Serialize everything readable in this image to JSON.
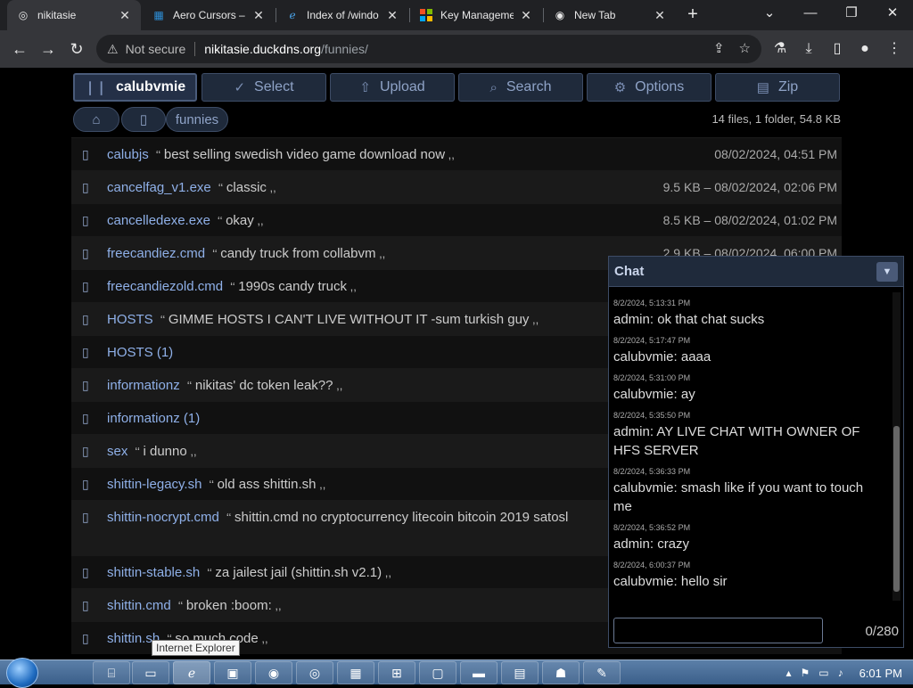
{
  "browser": {
    "tabs": [
      {
        "title": "nikitasie",
        "icon": "globe-icon",
        "active": true
      },
      {
        "title": "Aero Cursors – W",
        "icon": "windows-icon",
        "active": false
      },
      {
        "title": "Index of /windo",
        "icon": "ie-icon",
        "active": false
      },
      {
        "title": "Key Managemen",
        "icon": "microsoft-icon",
        "active": false
      },
      {
        "title": "New Tab",
        "icon": "chrome-icon",
        "active": false
      }
    ],
    "new_tab": "+",
    "address": {
      "security": "Not secure",
      "host": "nikitasie.duckdns.org",
      "path": "/funnies/"
    }
  },
  "hfs": {
    "buttons": [
      {
        "label": "calubvmie",
        "icon": "user-icon"
      },
      {
        "label": "Select",
        "icon": "check-icon"
      },
      {
        "label": "Upload",
        "icon": "upload-icon"
      },
      {
        "label": "Search",
        "icon": "search-icon"
      },
      {
        "label": "Options",
        "icon": "gear-icon"
      },
      {
        "label": "Zip",
        "icon": "zip-icon"
      }
    ],
    "breadcrumb": [
      {
        "label": "",
        "icon": "home-icon"
      },
      {
        "label": "",
        "icon": "folder-up-icon"
      },
      {
        "label": "funnies",
        "icon": ""
      }
    ],
    "summary": "14 files, 1 folder, 54.8 KB",
    "files": [
      {
        "name": "calubjs",
        "comment": "best selling swedish video game download now",
        "meta": "08/02/2024, 04:51 PM"
      },
      {
        "name": "cancelfag_v1.exe",
        "comment": "classic",
        "meta": "9.5 KB – 08/02/2024, 02:06 PM"
      },
      {
        "name": "cancelledexe.exe",
        "comment": "okay",
        "meta": "8.5 KB – 08/02/2024, 01:02 PM"
      },
      {
        "name": "freecandiez.cmd",
        "comment": "candy truck from collabvm",
        "meta": "2.9 KB – 08/02/2024, 06:00 PM"
      },
      {
        "name": "freecandiezold.cmd",
        "comment": "1990s candy truck",
        "meta": ""
      },
      {
        "name": "HOSTS",
        "comment": "GIMME HOSTS I CAN'T LIVE WITHOUT IT -sum turkish guy",
        "meta": ""
      },
      {
        "name": "HOSTS (1)",
        "comment": "",
        "meta": ""
      },
      {
        "name": "informationz",
        "comment": "nikitas' dc token leak??",
        "meta": ""
      },
      {
        "name": "informationz (1)",
        "comment": "",
        "meta": ""
      },
      {
        "name": "sex",
        "comment": "i dunno",
        "meta": ""
      },
      {
        "name": "shittin-legacy.sh",
        "comment": "old ass shittin.sh",
        "meta": ""
      },
      {
        "name": "shittin-nocrypt.cmd",
        "comment": "shittin.cmd no cryptocurrency litecoin bitcoin 2019 satosl",
        "meta": ""
      },
      {
        "name": "shittin-stable.sh",
        "comment": "za jailest jail (shittin.sh v2.1)",
        "meta": ""
      },
      {
        "name": "shittin.cmd",
        "comment": "broken :boom:",
        "meta": ""
      },
      {
        "name": "shittin.sh",
        "comment": "so much code",
        "meta": ""
      }
    ]
  },
  "chat": {
    "title": "Chat",
    "messages": [
      {
        "ts": "8/2/2024, 5:13:31 PM",
        "text": "admin: ok that chat sucks"
      },
      {
        "ts": "8/2/2024, 5:17:47 PM",
        "text": "calubvmie: aaaa"
      },
      {
        "ts": "8/2/2024, 5:31:00 PM",
        "text": "calubvmie: ay"
      },
      {
        "ts": "8/2/2024, 5:35:50 PM",
        "text": "admin: AY LIVE CHAT WITH OWNER OF HFS SERVER"
      },
      {
        "ts": "8/2/2024, 5:36:33 PM",
        "text": "calubvmie: smash like if you want to touch me"
      },
      {
        "ts": "8/2/2024, 5:36:52 PM",
        "text": "admin: crazy"
      },
      {
        "ts": "8/2/2024, 6:00:37 PM",
        "text": "calubvmie: hello sir"
      }
    ],
    "input_value": "",
    "counter": "0/280"
  },
  "taskbar": {
    "tooltip": "Internet Explorer",
    "clock": "6:01 PM"
  }
}
